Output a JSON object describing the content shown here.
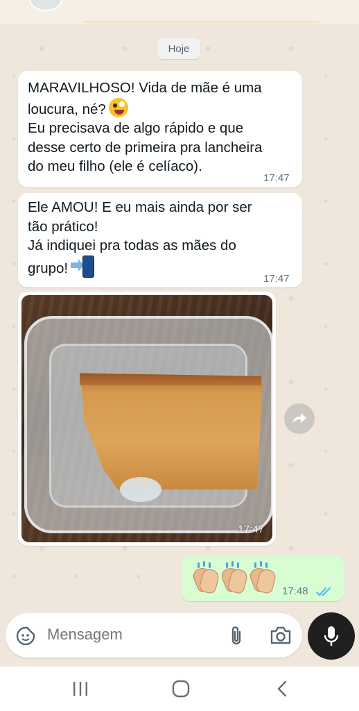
{
  "date_chip": "Hoje",
  "messages": [
    {
      "lines": [
        "MARAVILHOSO! Vida de mãe é uma",
        "loucura, né?",
        "Eu precisava de algo rápido e que",
        "desse certo de primeira pra lancheira",
        "do meu filho (ele é celíaco)."
      ],
      "time": "17:47"
    },
    {
      "lines": [
        "Ele AMOU! E eu mais ainda por ser",
        "tão prático!",
        "Já indiquei pra todas as mães do",
        "grupo!"
      ],
      "time": "17:47"
    }
  ],
  "image_message": {
    "time": "17:47",
    "alt": "cake-in-container-photo"
  },
  "outgoing_message": {
    "emoji": "clapping-hands x3",
    "time": "17:48",
    "status": "read"
  },
  "composer": {
    "placeholder": "Mensagem"
  },
  "colors": {
    "incoming_bubble": "#ffffff",
    "outgoing_bubble": "#d9fdd3",
    "chat_background": "#efe7dc",
    "read_tick": "#53bdeb",
    "mic_button": "#1f1f1f"
  },
  "icons": [
    "sticker-icon",
    "attach-icon",
    "camera-icon",
    "mic-icon",
    "forward-icon",
    "double-check-icon",
    "recent-apps-icon",
    "home-icon",
    "back-icon"
  ]
}
